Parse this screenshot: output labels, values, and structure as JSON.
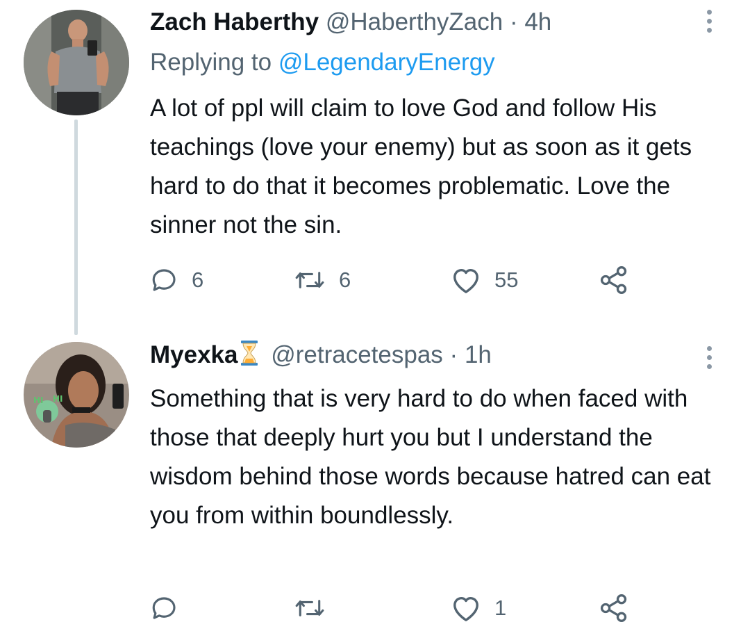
{
  "tweets": [
    {
      "name": "Zach Haberthy",
      "handle": "@HaberthyZach",
      "separator": "·",
      "time": "4h",
      "replying_prefix": "Replying to ",
      "replying_to": "@LegendaryEnergy",
      "text": "A lot of ppl will claim to love God and follow His teachings (love your enemy) but as soon as it gets hard to do that it becomes problematic. Love the sinner not the sin.",
      "counts": {
        "replies": "6",
        "retweets": "6",
        "likes": "55"
      }
    },
    {
      "name": "Myexka",
      "name_emoji": "hourglass-icon",
      "handle": "@retracetespas",
      "separator": "·",
      "time": "1h",
      "text": "Something that is very hard to do when faced with those that deeply hurt you but I understand the wisdom behind those words because hatred can eat you from within boundlessly.",
      "counts": {
        "replies": "",
        "retweets": "",
        "likes": "1"
      }
    }
  ],
  "colors": {
    "text": "#0f1419",
    "secondary": "#536471",
    "link": "#1d9bf0",
    "thread_line": "#cfd9de"
  },
  "icons": [
    "reply-icon",
    "retweet-icon",
    "like-icon",
    "share-icon",
    "more-icon"
  ]
}
